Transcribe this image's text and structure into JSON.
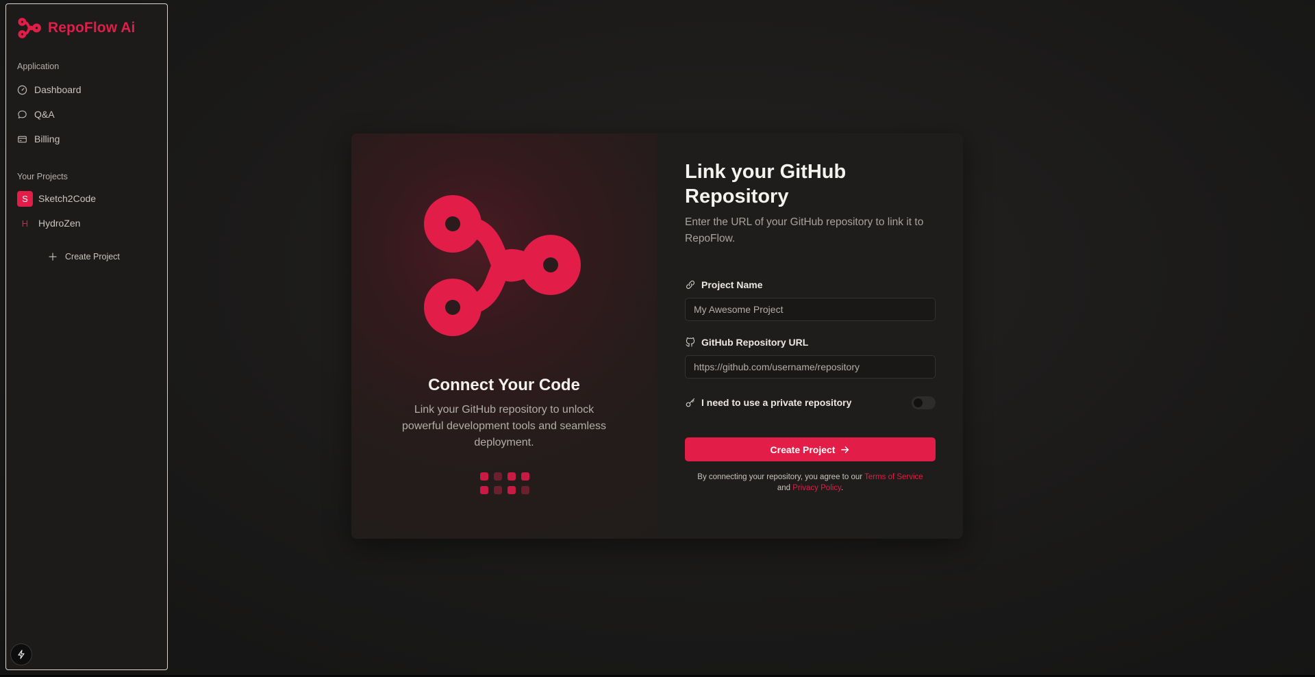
{
  "brand": {
    "name": "RepoFlow Ai",
    "accent": "#e11d48"
  },
  "sidebar": {
    "application_label": "Application",
    "nav": [
      {
        "label": "Dashboard",
        "icon": "dashboard-gauge-icon"
      },
      {
        "label": "Q&A",
        "icon": "chat-bubble-icon"
      },
      {
        "label": "Billing",
        "icon": "credit-card-icon"
      }
    ],
    "projects_label": "Your Projects",
    "projects": [
      {
        "initial": "S",
        "name": "Sketch2Code",
        "active": true
      },
      {
        "initial": "H",
        "name": "HydroZen",
        "active": false
      }
    ],
    "create_project_label": "Create Project",
    "footer_icon": "bolt-icon"
  },
  "hero": {
    "title": "Connect Your Code",
    "description": "Link your GitHub repository to unlock powerful development tools and seamless deployment."
  },
  "form": {
    "title": "Link your GitHub Repository",
    "subtitle": "Enter the URL of your GitHub repository to link it to RepoFlow.",
    "project_name_label": "Project Name",
    "project_name_placeholder": "My Awesome Project",
    "repo_url_label": "GitHub Repository URL",
    "repo_url_placeholder": "https://github.com/username/repository",
    "private_label": "I need to use a private repository",
    "private_enabled": false,
    "submit_label": "Create Project",
    "terms_prefix": "By connecting your repository, you agree to our ",
    "terms_link": "Terms of Service",
    "terms_and": "and ",
    "privacy_link": "Privacy Policy",
    "terms_suffix": "."
  }
}
